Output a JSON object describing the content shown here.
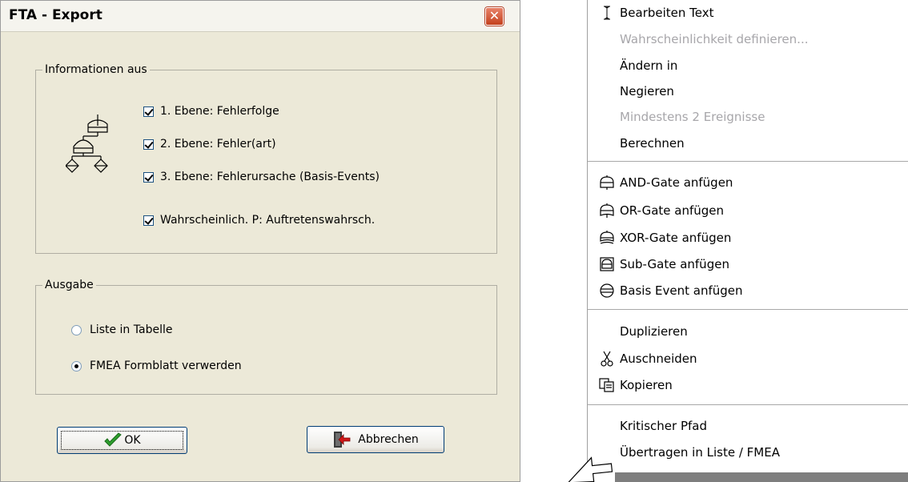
{
  "dialog": {
    "title": "FTA - Export",
    "info_group": {
      "legend": "Informationen aus",
      "checkboxes": [
        {
          "label": "1. Ebene: Fehlerfolge",
          "checked": true
        },
        {
          "label": "2. Ebene: Fehler(art)",
          "checked": true
        },
        {
          "label": "3. Ebene: Fehlerursache (Basis-Events)",
          "checked": true
        },
        {
          "label": "Wahrscheinlich. P: Auftretenswahrsch.",
          "checked": true
        }
      ]
    },
    "output_group": {
      "legend": "Ausgabe",
      "radios": [
        {
          "label": "Liste in Tabelle",
          "selected": false
        },
        {
          "label": "FMEA Formblatt verwerden",
          "selected": true
        }
      ]
    },
    "ok_label": "OK",
    "cancel_label": "Abbrechen"
  },
  "menu": {
    "items": [
      {
        "label": "Bearbeiten Text",
        "icon": "text-cursor-icon",
        "enabled": true
      },
      {
        "label": "Wahrscheinlichkeit definieren...",
        "enabled": false
      },
      {
        "label": "Ändern in",
        "enabled": true,
        "submenu": true
      },
      {
        "label": "Negieren",
        "enabled": true
      },
      {
        "label": "Mindestens 2 Ereignisse",
        "enabled": false
      },
      {
        "label": "Berechnen",
        "enabled": true
      },
      {
        "label": "AND-Gate anfügen",
        "icon": "and-gate-icon",
        "enabled": true
      },
      {
        "label": "OR-Gate anfügen",
        "icon": "or-gate-icon",
        "enabled": true
      },
      {
        "label": "XOR-Gate anfügen",
        "icon": "xor-gate-icon",
        "enabled": true
      },
      {
        "label": "Sub-Gate anfügen",
        "icon": "sub-gate-icon",
        "enabled": true
      },
      {
        "label": "Basis Event anfügen",
        "icon": "basis-event-icon",
        "enabled": true
      },
      {
        "label": "Duplizieren",
        "enabled": true
      },
      {
        "label": "Auschneiden",
        "icon": "scissors-icon",
        "enabled": true
      },
      {
        "label": "Kopieren",
        "icon": "copy-icon",
        "enabled": true
      },
      {
        "label": "Kritischer Pfad",
        "enabled": true
      },
      {
        "label": "Übertragen in Liste / FMEA",
        "enabled": true
      }
    ]
  },
  "colors": {
    "dialog_bg": "#ECE9D8",
    "close_button": "#D5502B",
    "ok_check": "#2E9E2E",
    "disabled_text": "#A7A6AA"
  }
}
